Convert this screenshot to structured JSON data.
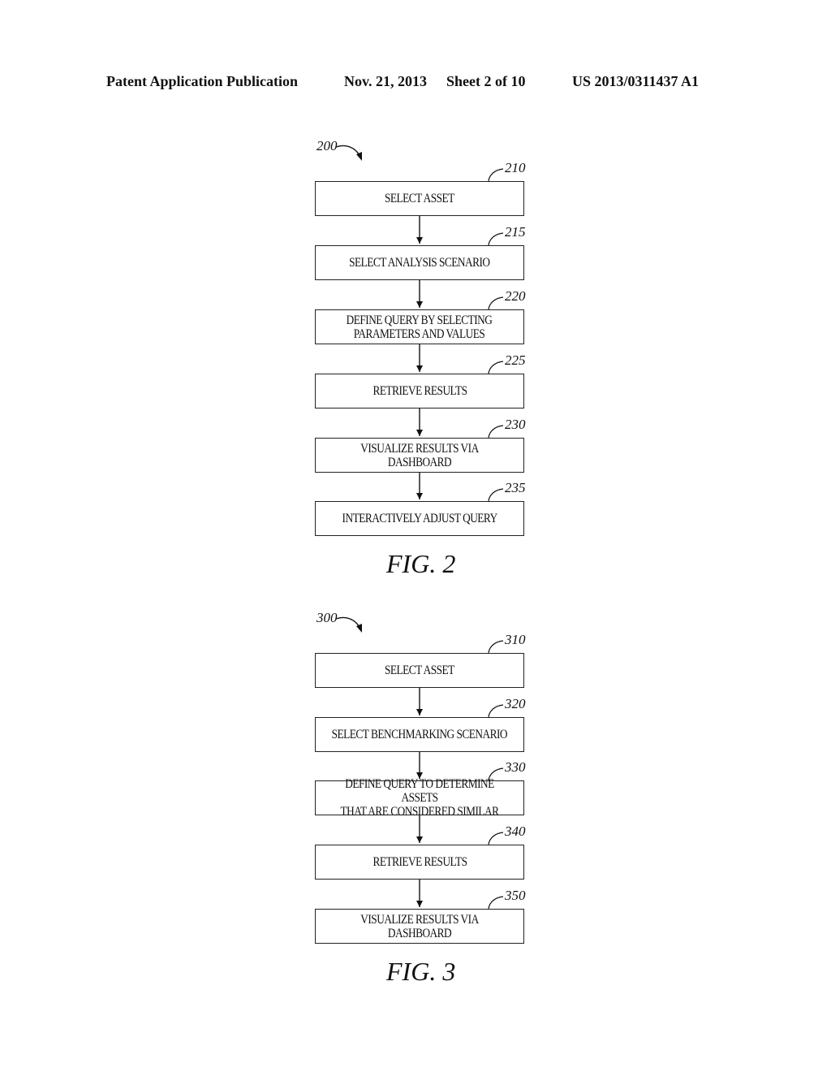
{
  "header": {
    "publication": "Patent Application Publication",
    "date": "Nov. 21, 2013",
    "sheet": "Sheet 2 of 10",
    "number": "US 2013/0311437 A1"
  },
  "figures": [
    {
      "label": "FIG. 2",
      "ref": "200",
      "steps": [
        {
          "ref": "210",
          "text": "SELECT ASSET"
        },
        {
          "ref": "215",
          "text": "SELECT ANALYSIS SCENARIO"
        },
        {
          "ref": "220",
          "text": "DEFINE QUERY BY SELECTING\nPARAMETERS AND VALUES"
        },
        {
          "ref": "225",
          "text": "RETRIEVE RESULTS"
        },
        {
          "ref": "230",
          "text": "VISUALIZE RESULTS VIA DASHBOARD"
        },
        {
          "ref": "235",
          "text": "INTERACTIVELY ADJUST QUERY"
        }
      ]
    },
    {
      "label": "FIG. 3",
      "ref": "300",
      "steps": [
        {
          "ref": "310",
          "text": "SELECT ASSET"
        },
        {
          "ref": "320",
          "text": "SELECT BENCHMARKING SCENARIO"
        },
        {
          "ref": "330",
          "text": "DEFINE QUERY TO DETERMINE ASSETS\nTHAT ARE CONSIDERED SIMILAR"
        },
        {
          "ref": "340",
          "text": "RETRIEVE RESULTS"
        },
        {
          "ref": "350",
          "text": "VISUALIZE RESULTS VIA DASHBOARD"
        }
      ]
    }
  ]
}
